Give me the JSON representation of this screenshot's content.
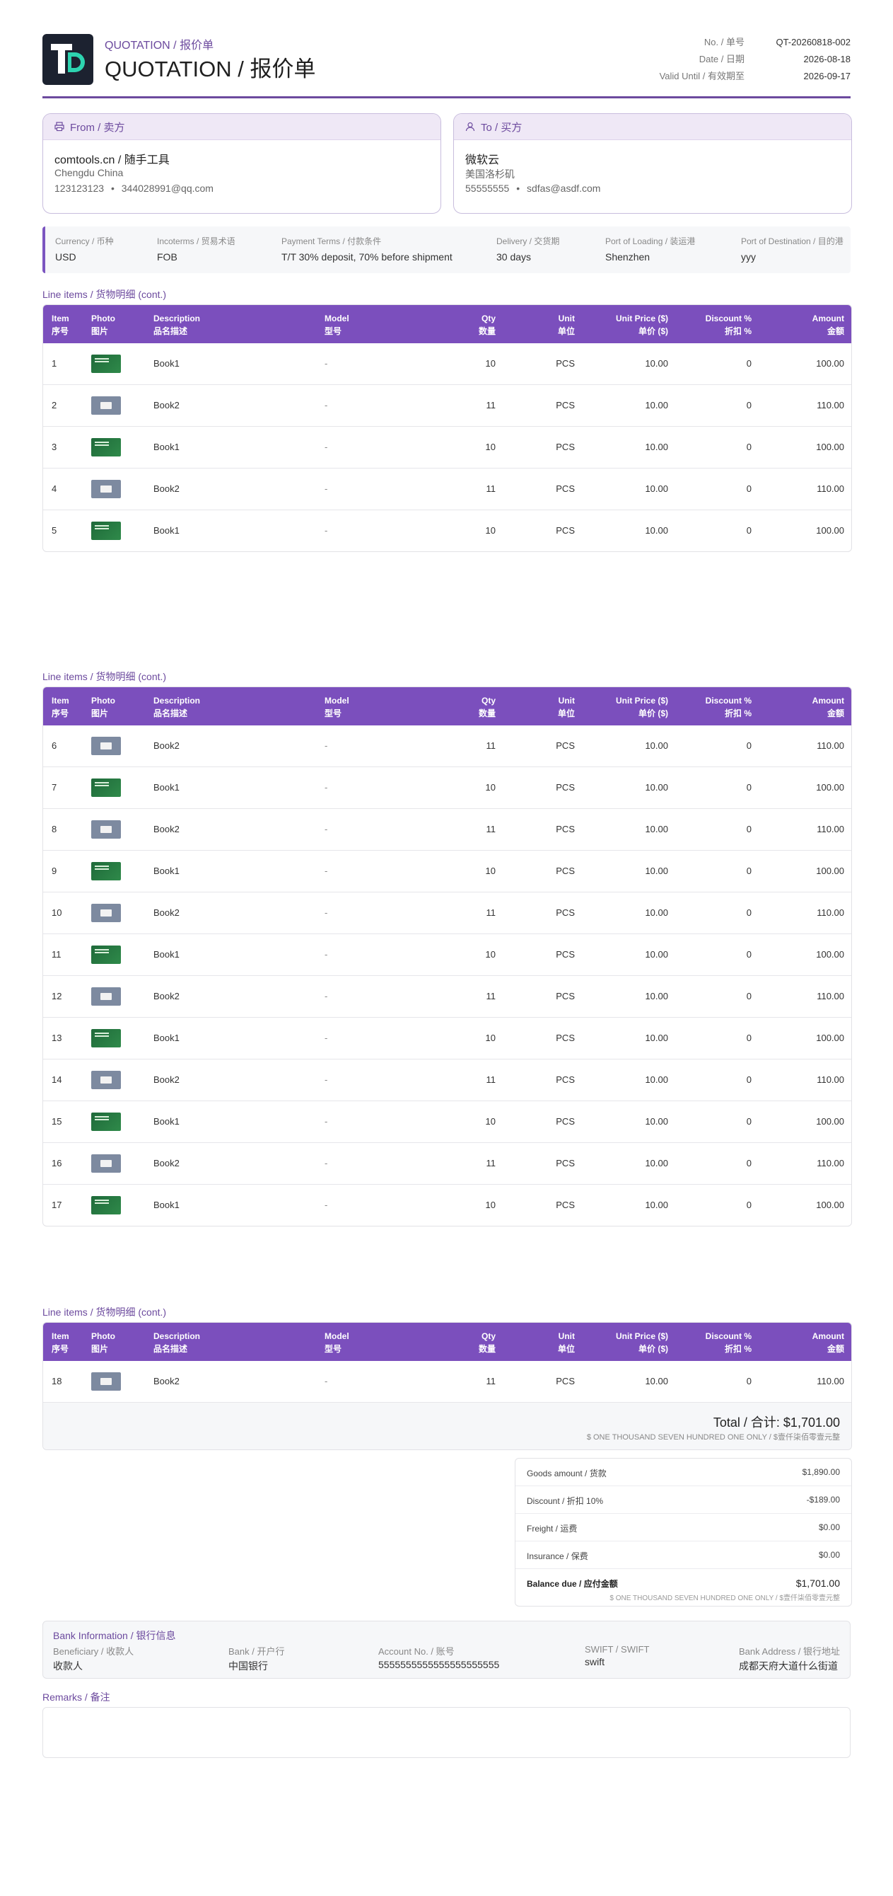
{
  "header": {
    "title_small": "QUOTATION / 报价单",
    "title_big": "QUOTATION / 报价单",
    "meta": [
      {
        "label": "No. / 单号",
        "value": "QT-20260818-002"
      },
      {
        "label": "Date / 日期",
        "value": "2026-08-18"
      },
      {
        "label": "Valid Until / 有效期至",
        "value": "2026-09-17"
      }
    ]
  },
  "from": {
    "heading": "From / 卖方",
    "name": "comtools.cn / 随手工具",
    "city": "Chengdu China",
    "phone": "123123123",
    "email": "344028991@qq.com",
    "sep": "•"
  },
  "to": {
    "heading": "To / 买方",
    "name": "微软云",
    "city": "美国洛杉矶",
    "phone": "55555555",
    "email": "sdfas@asdf.com",
    "sep": "•"
  },
  "terms": [
    {
      "label": "Currency / 币种",
      "value": "USD"
    },
    {
      "label": "Incoterms / 贸易术语",
      "value": "FOB"
    },
    {
      "label": "Payment Terms / 付款条件",
      "value": "T/T 30% deposit, 70% before shipment"
    },
    {
      "label": "Delivery / 交货期",
      "value": "30 days"
    },
    {
      "label": "Port of Loading / 装运港",
      "value": "Shenzhen"
    },
    {
      "label": "Port of Destination / 目的港",
      "value": "yyy"
    }
  ],
  "table": {
    "section_title": "Line items / 货物明细 (cont.)",
    "headers": [
      {
        "en": "Item",
        "cn": "序号"
      },
      {
        "en": "Photo",
        "cn": "图片"
      },
      {
        "en": "Description",
        "cn": "品名描述"
      },
      {
        "en": "Model",
        "cn": "型号"
      },
      {
        "en": "Qty",
        "cn": "数量"
      },
      {
        "en": "Unit",
        "cn": "单位"
      },
      {
        "en": "Unit Price ($)",
        "cn": "单价 ($)"
      },
      {
        "en": "Discount %",
        "cn": "折扣 %"
      },
      {
        "en": "Amount",
        "cn": "金额"
      }
    ],
    "rows": [
      {
        "item": "1",
        "photo": "green",
        "desc": "Book1",
        "model": "-",
        "qty": "10",
        "unit": "PCS",
        "price": "10.00",
        "disc": "0",
        "amount": "100.00"
      },
      {
        "item": "2",
        "photo": "gray",
        "desc": "Book2",
        "model": "-",
        "qty": "11",
        "unit": "PCS",
        "price": "10.00",
        "disc": "0",
        "amount": "110.00"
      },
      {
        "item": "3",
        "photo": "green",
        "desc": "Book1",
        "model": "-",
        "qty": "10",
        "unit": "PCS",
        "price": "10.00",
        "disc": "0",
        "amount": "100.00"
      },
      {
        "item": "4",
        "photo": "gray",
        "desc": "Book2",
        "model": "-",
        "qty": "11",
        "unit": "PCS",
        "price": "10.00",
        "disc": "0",
        "amount": "110.00"
      },
      {
        "item": "5",
        "photo": "green",
        "desc": "Book1",
        "model": "-",
        "qty": "10",
        "unit": "PCS",
        "price": "10.00",
        "disc": "0",
        "amount": "100.00"
      },
      {
        "item": "6",
        "photo": "gray",
        "desc": "Book2",
        "model": "-",
        "qty": "11",
        "unit": "PCS",
        "price": "10.00",
        "disc": "0",
        "amount": "110.00"
      },
      {
        "item": "7",
        "photo": "green",
        "desc": "Book1",
        "model": "-",
        "qty": "10",
        "unit": "PCS",
        "price": "10.00",
        "disc": "0",
        "amount": "100.00"
      },
      {
        "item": "8",
        "photo": "gray",
        "desc": "Book2",
        "model": "-",
        "qty": "11",
        "unit": "PCS",
        "price": "10.00",
        "disc": "0",
        "amount": "110.00"
      },
      {
        "item": "9",
        "photo": "green",
        "desc": "Book1",
        "model": "-",
        "qty": "10",
        "unit": "PCS",
        "price": "10.00",
        "disc": "0",
        "amount": "100.00"
      },
      {
        "item": "10",
        "photo": "gray",
        "desc": "Book2",
        "model": "-",
        "qty": "11",
        "unit": "PCS",
        "price": "10.00",
        "disc": "0",
        "amount": "110.00"
      },
      {
        "item": "11",
        "photo": "green",
        "desc": "Book1",
        "model": "-",
        "qty": "10",
        "unit": "PCS",
        "price": "10.00",
        "disc": "0",
        "amount": "100.00"
      },
      {
        "item": "12",
        "photo": "gray",
        "desc": "Book2",
        "model": "-",
        "qty": "11",
        "unit": "PCS",
        "price": "10.00",
        "disc": "0",
        "amount": "110.00"
      },
      {
        "item": "13",
        "photo": "green",
        "desc": "Book1",
        "model": "-",
        "qty": "10",
        "unit": "PCS",
        "price": "10.00",
        "disc": "0",
        "amount": "100.00"
      },
      {
        "item": "14",
        "photo": "gray",
        "desc": "Book2",
        "model": "-",
        "qty": "11",
        "unit": "PCS",
        "price": "10.00",
        "disc": "0",
        "amount": "110.00"
      },
      {
        "item": "15",
        "photo": "green",
        "desc": "Book1",
        "model": "-",
        "qty": "10",
        "unit": "PCS",
        "price": "10.00",
        "disc": "0",
        "amount": "100.00"
      },
      {
        "item": "16",
        "photo": "gray",
        "desc": "Book2",
        "model": "-",
        "qty": "11",
        "unit": "PCS",
        "price": "10.00",
        "disc": "0",
        "amount": "110.00"
      },
      {
        "item": "17",
        "photo": "green",
        "desc": "Book1",
        "model": "-",
        "qty": "10",
        "unit": "PCS",
        "price": "10.00",
        "disc": "0",
        "amount": "100.00"
      },
      {
        "item": "18",
        "photo": "gray",
        "desc": "Book2",
        "model": "-",
        "qty": "11",
        "unit": "PCS",
        "price": "10.00",
        "disc": "0",
        "amount": "110.00"
      }
    ],
    "total_label": "Total / 合计: $1,701.00",
    "total_words": "$ ONE THOUSAND SEVEN HUNDRED ONE ONLY / $壹仟柒佰零壹元整"
  },
  "summary": {
    "rows": [
      {
        "label": "Goods amount / 货款",
        "value": "$1,890.00"
      },
      {
        "label": "Discount / 折扣 10%",
        "value": "-$189.00"
      },
      {
        "label": "Freight / 运费",
        "value": "$0.00"
      },
      {
        "label": "Insurance / 保费",
        "value": "$0.00"
      }
    ],
    "due_label": "Balance due / 应付金额",
    "due_value": "$1,701.00",
    "due_words": "$ ONE THOUSAND SEVEN HUNDRED ONE ONLY / $壹仟柒佰零壹元整"
  },
  "bank": {
    "title": "Bank Information / 银行信息",
    "fields": [
      {
        "label": "Beneficiary / 收款人",
        "value": "收款人"
      },
      {
        "label": "Bank / 开户行",
        "value": "中国银行"
      },
      {
        "label": "Account No. / 账号",
        "value": "5555555555555555555555"
      },
      {
        "label": "SWIFT / SWIFT",
        "value": "swift"
      },
      {
        "label": "Bank Address / 银行地址",
        "value": "成都天府大道什么街道"
      }
    ]
  },
  "remarks": {
    "title": "Remarks / 备注",
    "text": ""
  },
  "colors": {
    "accent": "#7b4fbd",
    "accent_text": "#6c4a9e",
    "header_bg": "#1c2230"
  },
  "icons": {
    "from": "printer-icon",
    "to": "user-icon"
  }
}
